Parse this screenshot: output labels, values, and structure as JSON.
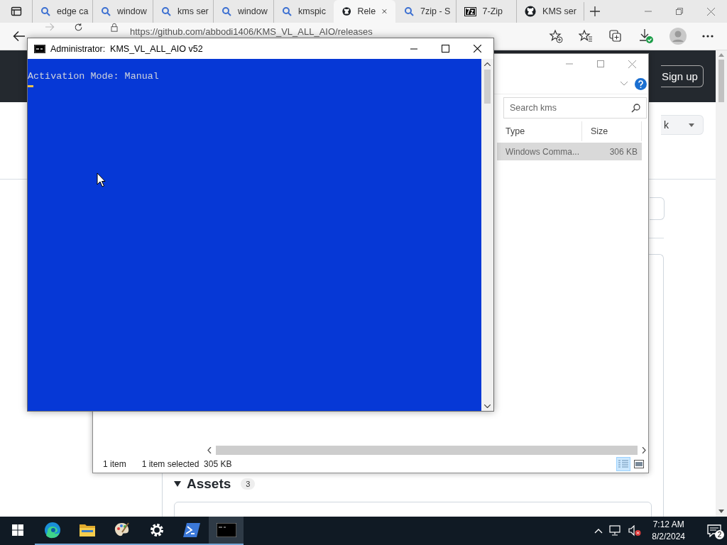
{
  "browser": {
    "tabs": [
      {
        "kind": "search",
        "label": "edge ca",
        "selected": false
      },
      {
        "kind": "search",
        "label": "window",
        "selected": false
      },
      {
        "kind": "search",
        "label": "kms ser",
        "selected": false
      },
      {
        "kind": "search",
        "label": "window",
        "selected": false
      },
      {
        "kind": "search",
        "label": "kmspic",
        "selected": false
      },
      {
        "kind": "logo",
        "label": "Rele",
        "selected": true
      },
      {
        "kind": "search",
        "label": "7zip - S",
        "selected": false
      },
      {
        "kind": "badge",
        "badge": "7z",
        "label": "7-Zip",
        "selected": false
      },
      {
        "kind": "logo",
        "label": "KMS ser",
        "selected": false
      }
    ],
    "url": "https://github.com/abbodi1406/KMS_VL_ALL_AIO/releases",
    "page": {
      "signup": "Sign up",
      "branch_button": "k",
      "assets": {
        "title": "Assets",
        "count": "3"
      }
    }
  },
  "explorer": {
    "search_placeholder": "Search kms",
    "columns": [
      "Type",
      "Size"
    ],
    "rows": [
      {
        "type": "Windows Comma...",
        "size": "306 KB",
        "selected": true
      }
    ],
    "status": {
      "items": "1 item",
      "selection": "1 item selected  305 KB"
    },
    "views": [
      {
        "kind": "details",
        "selected": true
      },
      {
        "kind": "preview",
        "selected": false
      }
    ]
  },
  "console": {
    "title": "Administrator:  KMS_VL_ALL_AIO v52",
    "lines": [
      "Activation Mode: Manual"
    ]
  },
  "taskbar": {
    "apps": [
      {
        "kind": "browser",
        "running": true,
        "selected": false
      },
      {
        "kind": "folder",
        "running": true,
        "selected": false
      },
      {
        "kind": "paint",
        "running": true,
        "selected": false
      },
      {
        "kind": "settings",
        "running": true,
        "selected": false
      },
      {
        "kind": "powershell",
        "running": true,
        "selected": false
      },
      {
        "kind": "console",
        "running": true,
        "selected": true
      }
    ],
    "time": "7:12 AM",
    "date": "8/2/2024",
    "notifications": "2"
  }
}
